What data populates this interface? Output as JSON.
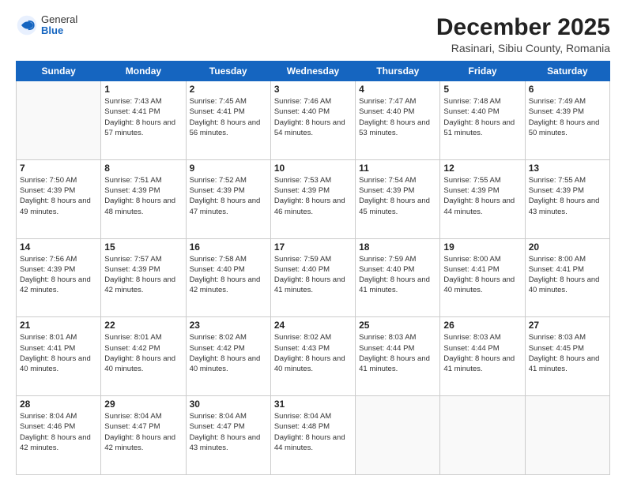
{
  "header": {
    "logo_general": "General",
    "logo_blue": "Blue",
    "month_title": "December 2025",
    "location": "Rasinari, Sibiu County, Romania"
  },
  "days_of_week": [
    "Sunday",
    "Monday",
    "Tuesday",
    "Wednesday",
    "Thursday",
    "Friday",
    "Saturday"
  ],
  "weeks": [
    [
      {
        "day": "",
        "sunrise": "",
        "sunset": "",
        "daylight": ""
      },
      {
        "day": "1",
        "sunrise": "Sunrise: 7:43 AM",
        "sunset": "Sunset: 4:41 PM",
        "daylight": "Daylight: 8 hours and 57 minutes."
      },
      {
        "day": "2",
        "sunrise": "Sunrise: 7:45 AM",
        "sunset": "Sunset: 4:41 PM",
        "daylight": "Daylight: 8 hours and 56 minutes."
      },
      {
        "day": "3",
        "sunrise": "Sunrise: 7:46 AM",
        "sunset": "Sunset: 4:40 PM",
        "daylight": "Daylight: 8 hours and 54 minutes."
      },
      {
        "day": "4",
        "sunrise": "Sunrise: 7:47 AM",
        "sunset": "Sunset: 4:40 PM",
        "daylight": "Daylight: 8 hours and 53 minutes."
      },
      {
        "day": "5",
        "sunrise": "Sunrise: 7:48 AM",
        "sunset": "Sunset: 4:40 PM",
        "daylight": "Daylight: 8 hours and 51 minutes."
      },
      {
        "day": "6",
        "sunrise": "Sunrise: 7:49 AM",
        "sunset": "Sunset: 4:39 PM",
        "daylight": "Daylight: 8 hours and 50 minutes."
      }
    ],
    [
      {
        "day": "7",
        "sunrise": "Sunrise: 7:50 AM",
        "sunset": "Sunset: 4:39 PM",
        "daylight": "Daylight: 8 hours and 49 minutes."
      },
      {
        "day": "8",
        "sunrise": "Sunrise: 7:51 AM",
        "sunset": "Sunset: 4:39 PM",
        "daylight": "Daylight: 8 hours and 48 minutes."
      },
      {
        "day": "9",
        "sunrise": "Sunrise: 7:52 AM",
        "sunset": "Sunset: 4:39 PM",
        "daylight": "Daylight: 8 hours and 47 minutes."
      },
      {
        "day": "10",
        "sunrise": "Sunrise: 7:53 AM",
        "sunset": "Sunset: 4:39 PM",
        "daylight": "Daylight: 8 hours and 46 minutes."
      },
      {
        "day": "11",
        "sunrise": "Sunrise: 7:54 AM",
        "sunset": "Sunset: 4:39 PM",
        "daylight": "Daylight: 8 hours and 45 minutes."
      },
      {
        "day": "12",
        "sunrise": "Sunrise: 7:55 AM",
        "sunset": "Sunset: 4:39 PM",
        "daylight": "Daylight: 8 hours and 44 minutes."
      },
      {
        "day": "13",
        "sunrise": "Sunrise: 7:55 AM",
        "sunset": "Sunset: 4:39 PM",
        "daylight": "Daylight: 8 hours and 43 minutes."
      }
    ],
    [
      {
        "day": "14",
        "sunrise": "Sunrise: 7:56 AM",
        "sunset": "Sunset: 4:39 PM",
        "daylight": "Daylight: 8 hours and 42 minutes."
      },
      {
        "day": "15",
        "sunrise": "Sunrise: 7:57 AM",
        "sunset": "Sunset: 4:39 PM",
        "daylight": "Daylight: 8 hours and 42 minutes."
      },
      {
        "day": "16",
        "sunrise": "Sunrise: 7:58 AM",
        "sunset": "Sunset: 4:40 PM",
        "daylight": "Daylight: 8 hours and 42 minutes."
      },
      {
        "day": "17",
        "sunrise": "Sunrise: 7:59 AM",
        "sunset": "Sunset: 4:40 PM",
        "daylight": "Daylight: 8 hours and 41 minutes."
      },
      {
        "day": "18",
        "sunrise": "Sunrise: 7:59 AM",
        "sunset": "Sunset: 4:40 PM",
        "daylight": "Daylight: 8 hours and 41 minutes."
      },
      {
        "day": "19",
        "sunrise": "Sunrise: 8:00 AM",
        "sunset": "Sunset: 4:41 PM",
        "daylight": "Daylight: 8 hours and 40 minutes."
      },
      {
        "day": "20",
        "sunrise": "Sunrise: 8:00 AM",
        "sunset": "Sunset: 4:41 PM",
        "daylight": "Daylight: 8 hours and 40 minutes."
      }
    ],
    [
      {
        "day": "21",
        "sunrise": "Sunrise: 8:01 AM",
        "sunset": "Sunset: 4:41 PM",
        "daylight": "Daylight: 8 hours and 40 minutes."
      },
      {
        "day": "22",
        "sunrise": "Sunrise: 8:01 AM",
        "sunset": "Sunset: 4:42 PM",
        "daylight": "Daylight: 8 hours and 40 minutes."
      },
      {
        "day": "23",
        "sunrise": "Sunrise: 8:02 AM",
        "sunset": "Sunset: 4:42 PM",
        "daylight": "Daylight: 8 hours and 40 minutes."
      },
      {
        "day": "24",
        "sunrise": "Sunrise: 8:02 AM",
        "sunset": "Sunset: 4:43 PM",
        "daylight": "Daylight: 8 hours and 40 minutes."
      },
      {
        "day": "25",
        "sunrise": "Sunrise: 8:03 AM",
        "sunset": "Sunset: 4:44 PM",
        "daylight": "Daylight: 8 hours and 41 minutes."
      },
      {
        "day": "26",
        "sunrise": "Sunrise: 8:03 AM",
        "sunset": "Sunset: 4:44 PM",
        "daylight": "Daylight: 8 hours and 41 minutes."
      },
      {
        "day": "27",
        "sunrise": "Sunrise: 8:03 AM",
        "sunset": "Sunset: 4:45 PM",
        "daylight": "Daylight: 8 hours and 41 minutes."
      }
    ],
    [
      {
        "day": "28",
        "sunrise": "Sunrise: 8:04 AM",
        "sunset": "Sunset: 4:46 PM",
        "daylight": "Daylight: 8 hours and 42 minutes."
      },
      {
        "day": "29",
        "sunrise": "Sunrise: 8:04 AM",
        "sunset": "Sunset: 4:47 PM",
        "daylight": "Daylight: 8 hours and 42 minutes."
      },
      {
        "day": "30",
        "sunrise": "Sunrise: 8:04 AM",
        "sunset": "Sunset: 4:47 PM",
        "daylight": "Daylight: 8 hours and 43 minutes."
      },
      {
        "day": "31",
        "sunrise": "Sunrise: 8:04 AM",
        "sunset": "Sunset: 4:48 PM",
        "daylight": "Daylight: 8 hours and 44 minutes."
      },
      {
        "day": "",
        "sunrise": "",
        "sunset": "",
        "daylight": ""
      },
      {
        "day": "",
        "sunrise": "",
        "sunset": "",
        "daylight": ""
      },
      {
        "day": "",
        "sunrise": "",
        "sunset": "",
        "daylight": ""
      }
    ]
  ]
}
